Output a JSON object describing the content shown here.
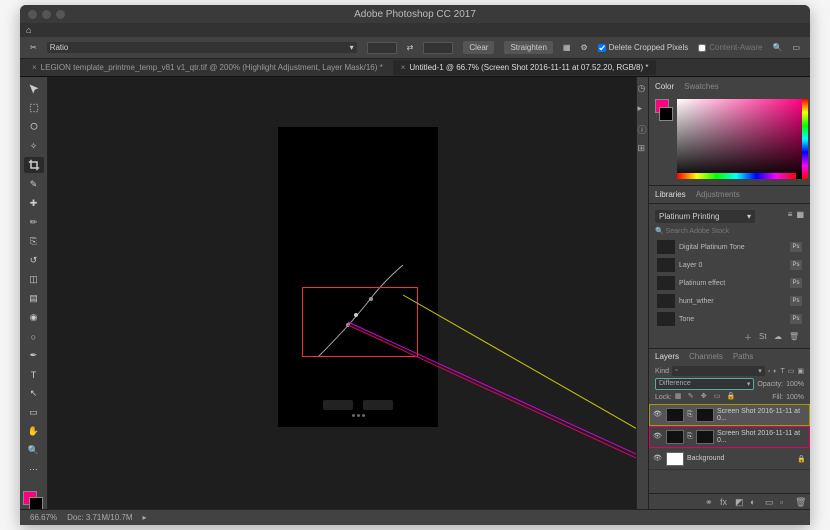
{
  "title": "Adobe Photoshop CC 2017",
  "optionsBar": {
    "ratio_label": "Ratio",
    "clear": "Clear",
    "straighten": "Straighten",
    "delete_cropped": "Delete Cropped Pixels",
    "content_aware": "Content-Aware"
  },
  "tabs": [
    {
      "label": "LEGION template_printme_temp_v81 v1_qtr.tif @ 200% (Highlight Adjustment, Layer Mask/16) *",
      "active": false
    },
    {
      "label": "Untitled-1 @ 66.7% (Screen Shot 2016-11-11 at 07.52.20, RGB/8) *",
      "active": true
    }
  ],
  "panels": {
    "color": {
      "tab1": "Color",
      "tab2": "Swatches"
    },
    "libraries": {
      "tab1": "Libraries",
      "tab2": "Adjustments",
      "library_name": "Platinum Printing",
      "search_placeholder": "Search Adobe Stock",
      "items": [
        {
          "label": "Digital Platinum Tone"
        },
        {
          "label": "Layer 0"
        },
        {
          "label": "Platinum effect"
        },
        {
          "label": "hunt_wther"
        },
        {
          "label": "Tone"
        }
      ]
    },
    "layers": {
      "tab1": "Layers",
      "tab2": "Channels",
      "tab3": "Paths",
      "kind_label": "Kind",
      "blend_mode": "Difference",
      "opacity_label": "Opacity:",
      "opacity_value": "100%",
      "lock_label": "Lock:",
      "fill_label": "Fill:",
      "fill_value": "100%",
      "items": [
        {
          "name": "Screen Shot 2016-11-11 at 0...",
          "hl": "o"
        },
        {
          "name": "Screen Shot 2016-11-11 at 0...",
          "hl": "m"
        },
        {
          "name": "Background"
        }
      ]
    }
  },
  "status": {
    "zoom": "66.67%",
    "doc": "Doc: 3.71M/10.7M"
  }
}
